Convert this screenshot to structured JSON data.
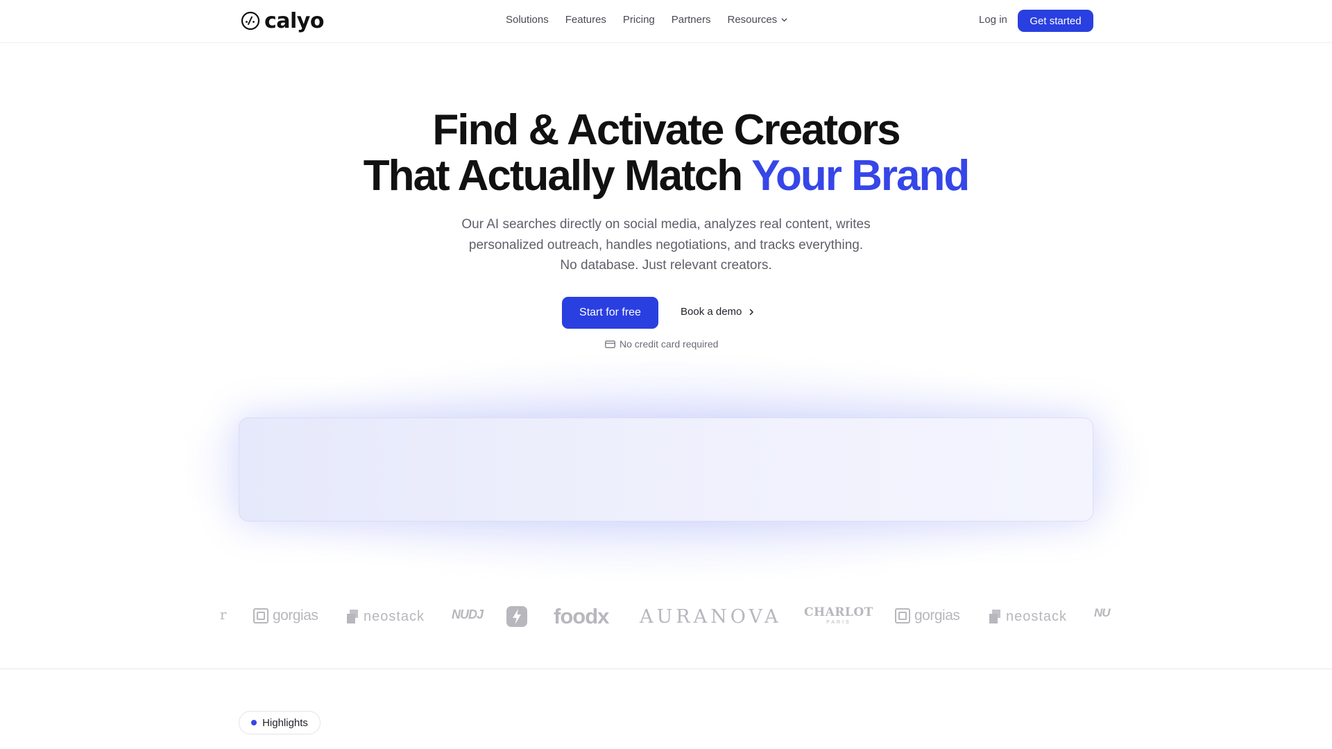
{
  "brand": {
    "name": "calyo",
    "accent": "#2a3fe0"
  },
  "nav": {
    "items": [
      "Solutions",
      "Features",
      "Pricing",
      "Partners",
      "Resources"
    ],
    "login": "Log in",
    "cta": "Get started"
  },
  "hero": {
    "title_line1": "Find & Activate Creators",
    "title_line2_prefix": "That Actually Match ",
    "title_line2_accent": "Your Brand",
    "subtitle": [
      "Our AI searches directly on social media, analyzes real content, writes",
      "personalized outreach, handles negotiations, and tracks everything.",
      "No database. Just relevant creators."
    ],
    "primary_cta": "Start for free",
    "secondary_cta": "Book a demo",
    "note": "No credit card required"
  },
  "logos": [
    "r",
    "gorgias",
    "neostack",
    "NUDJ",
    "bolt",
    "foodx",
    "AURANOVA",
    "CHARLOT",
    "PARIS",
    "gorgias",
    "neostack",
    "NU"
  ],
  "section": {
    "pill": "Highlights"
  }
}
